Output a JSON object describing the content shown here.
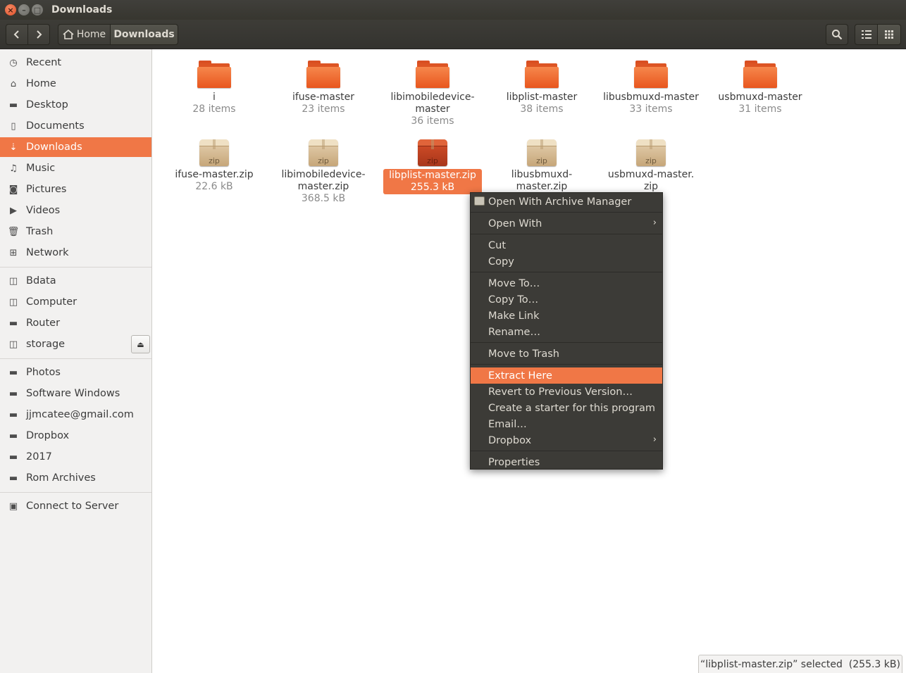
{
  "window": {
    "title": "Downloads"
  },
  "toolbar": {
    "back_icon": "‹",
    "forward_icon": "›",
    "breadcrumb_home": "Home",
    "breadcrumb_current": "Downloads"
  },
  "sidebar": {
    "places": [
      {
        "label": "Recent",
        "icon": "clock-icon",
        "active": false
      },
      {
        "label": "Home",
        "icon": "home-icon",
        "active": false
      },
      {
        "label": "Desktop",
        "icon": "folder-icon",
        "active": false
      },
      {
        "label": "Documents",
        "icon": "document-icon",
        "active": false
      },
      {
        "label": "Downloads",
        "icon": "download-icon",
        "active": true
      },
      {
        "label": "Music",
        "icon": "music-icon",
        "active": false
      },
      {
        "label": "Pictures",
        "icon": "camera-icon",
        "active": false
      },
      {
        "label": "Videos",
        "icon": "video-icon",
        "active": false
      },
      {
        "label": "Trash",
        "icon": "trash-icon",
        "active": false
      },
      {
        "label": "Network",
        "icon": "network-icon",
        "active": false
      }
    ],
    "devices": [
      {
        "label": "Bdata",
        "icon": "drive-icon"
      },
      {
        "label": "Computer",
        "icon": "drive-icon"
      },
      {
        "label": "Router",
        "icon": "folder-icon"
      },
      {
        "label": "storage",
        "icon": "drive-icon",
        "eject": true
      }
    ],
    "bookmarks": [
      {
        "label": "Photos",
        "icon": "folder-icon"
      },
      {
        "label": "Software Windows",
        "icon": "folder-icon"
      },
      {
        "label": "jjmcatee@gmail.com",
        "icon": "folder-icon"
      },
      {
        "label": "Dropbox",
        "icon": "folder-icon"
      },
      {
        "label": "2017",
        "icon": "folder-icon"
      },
      {
        "label": "Rom Archives",
        "icon": "folder-icon"
      }
    ],
    "connect": {
      "label": "Connect to Server",
      "icon": "server-icon"
    }
  },
  "files": {
    "folders": [
      {
        "name": "i",
        "meta": "28 items"
      },
      {
        "name": "ifuse-master",
        "meta": "23 items"
      },
      {
        "name": "libimobiledevice-\nmaster",
        "meta": "36 items"
      },
      {
        "name": "libplist-master",
        "meta": "38 items"
      },
      {
        "name": "libusbmuxd-master",
        "meta": "33 items"
      },
      {
        "name": "usbmuxd-master",
        "meta": "31 items"
      }
    ],
    "zip_badge": "zip",
    "zips": [
      {
        "name": "ifuse-master.zip",
        "meta": "22.6 kB",
        "selected": false
      },
      {
        "name": "libimobiledevice-\nmaster.zip",
        "meta": "368.5 kB",
        "selected": false
      },
      {
        "name": "libplist-master.zip",
        "meta": "255.3 kB",
        "selected": true
      },
      {
        "name": "libusbmuxd-\nmaster.zip",
        "meta": "",
        "selected": false
      },
      {
        "name": "usbmuxd-master.\nzip",
        "meta": "",
        "selected": false
      }
    ]
  },
  "context_menu": {
    "items": [
      {
        "label": "Open With Archive Manager",
        "icon": "archive-manager-icon"
      },
      {
        "label": "Open With",
        "submenu": true
      },
      {
        "label": "Cut"
      },
      {
        "label": "Copy"
      },
      {
        "label": "Move To…"
      },
      {
        "label": "Copy To…"
      },
      {
        "label": "Make Link"
      },
      {
        "label": "Rename…"
      },
      {
        "label": "Move to Trash"
      },
      {
        "label": "Extract Here",
        "highlighted": true
      },
      {
        "label": "Revert to Previous Version…"
      },
      {
        "label": "Create a starter for this program"
      },
      {
        "label": "Email…"
      },
      {
        "label": "Dropbox",
        "submenu": true
      },
      {
        "label": "Properties"
      }
    ]
  },
  "status": {
    "text": "“libplist-master.zip” selected  (255.3 kB)"
  },
  "colors": {
    "accent": "#f07746",
    "menu_bg": "#3c3b37",
    "titlebar": "#3c3b37"
  }
}
